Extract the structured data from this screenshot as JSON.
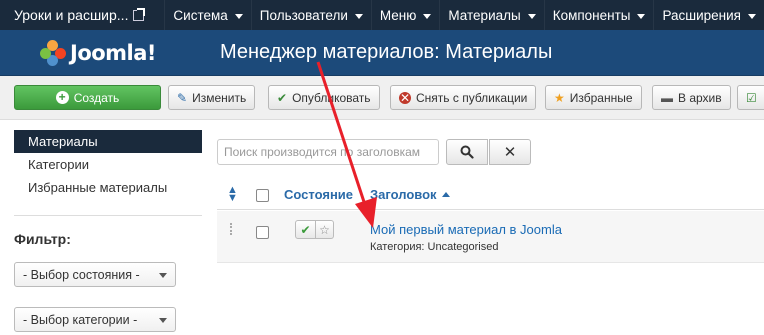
{
  "navbar": {
    "site_name": "Уроки и расшир...",
    "menu": [
      "Система",
      "Пользователи",
      "Меню",
      "Материалы",
      "Компоненты",
      "Расширения"
    ]
  },
  "header": {
    "logo_text": "Joomla!",
    "title": "Менеджер материалов: Материалы"
  },
  "toolbar": {
    "new": "Создать",
    "edit": "Изменить",
    "publish": "Опубликовать",
    "unpublish": "Снять с публикации",
    "featured": "Избранные",
    "archive": "В архив"
  },
  "sidebar": {
    "items": [
      "Материалы",
      "Категории",
      "Избранные материалы"
    ],
    "filter_title": "Фильтр:",
    "select_state": "- Выбор состояния -",
    "select_category": "- Выбор категории -"
  },
  "search": {
    "placeholder": "Поиск производится по заголовкам"
  },
  "table": {
    "col_status": "Состояние",
    "col_title": "Заголовок",
    "rows": [
      {
        "title": "Мой первый материал в Joomla",
        "category": "Категория: Uncategorised"
      }
    ]
  },
  "colors": {
    "navbar_bg": "#1a2a3c",
    "header_bg": "#1c4a7a",
    "new_button": "#4cae4c",
    "link": "#1a6bb5",
    "annotation_arrow": "#e8202a"
  }
}
